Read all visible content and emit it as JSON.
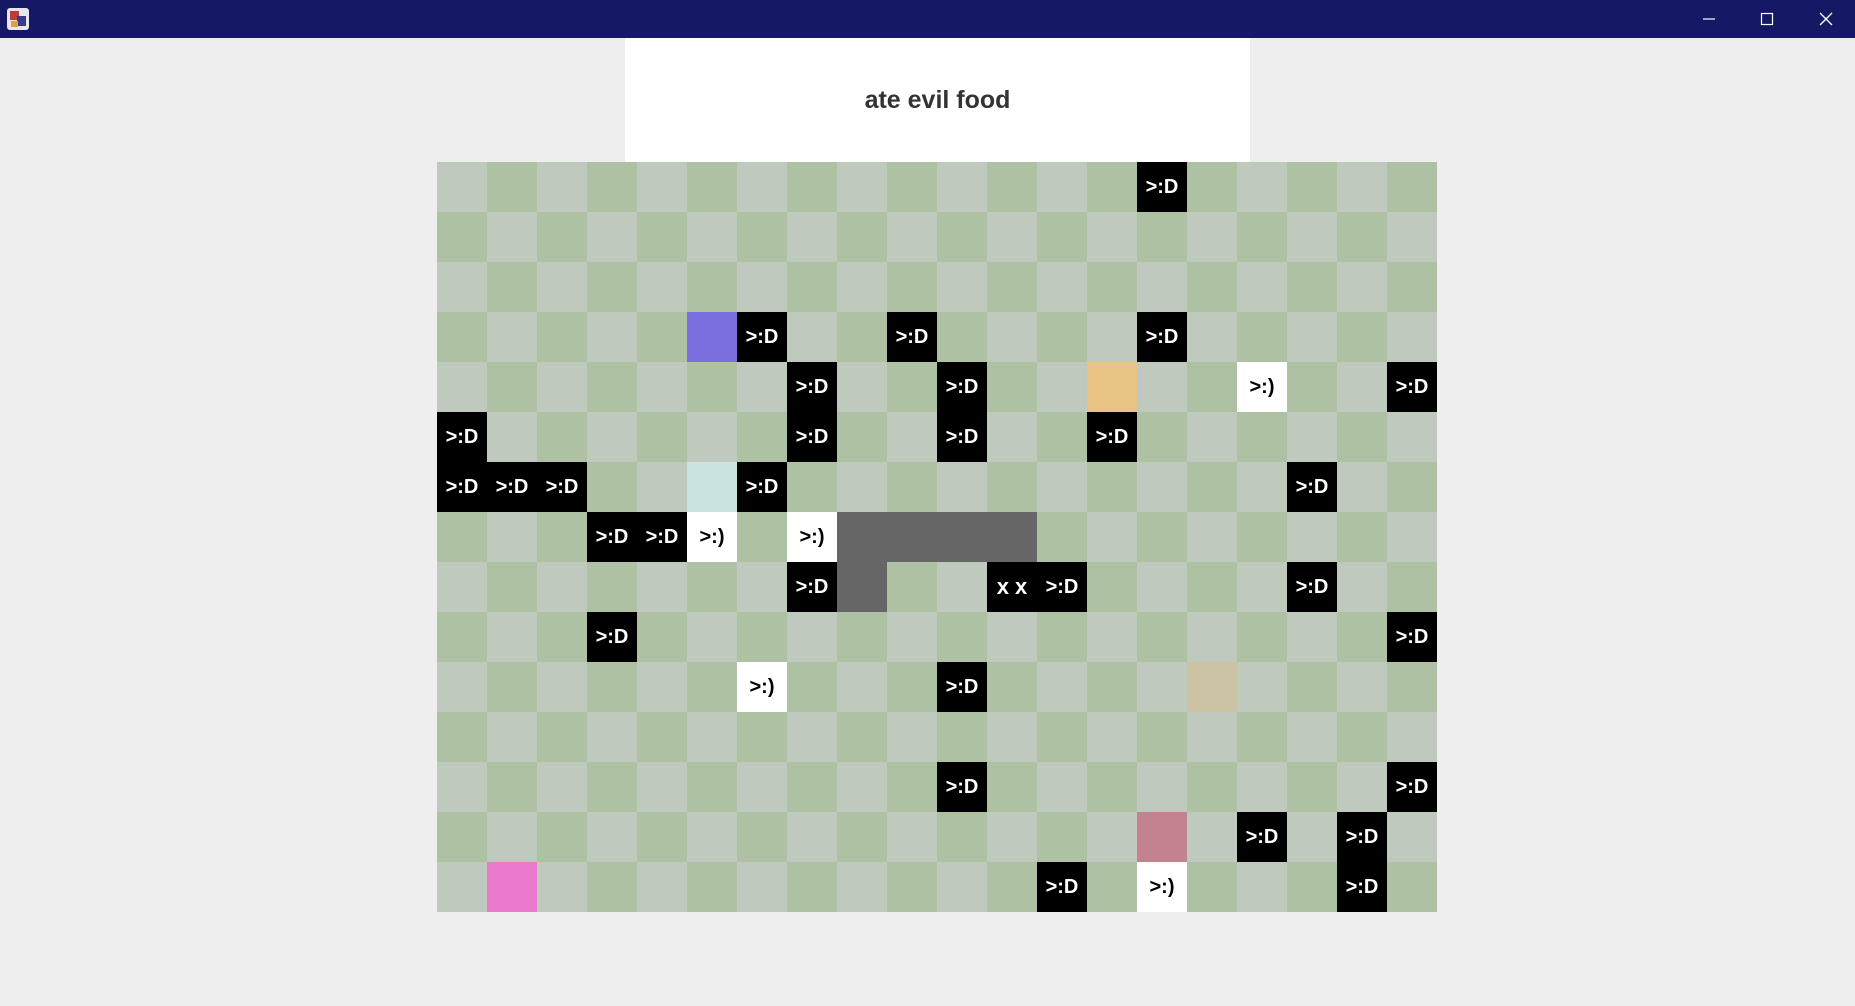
{
  "window": {
    "app_icon": "java-app-icon",
    "controls": [
      "minimize-icon",
      "maximize-icon",
      "close-icon"
    ]
  },
  "status": {
    "message": "ate evil food"
  },
  "board": {
    "cols": 20,
    "rows": 15,
    "checker_colors": {
      "light": "#bfc9be",
      "dark": "#aec1a3"
    },
    "evil_food_label": ">:D",
    "good_food_label": ">:)",
    "snake_head_label": "x x",
    "evil_food": [
      [
        14,
        0
      ],
      [
        6,
        3
      ],
      [
        9,
        3
      ],
      [
        14,
        3
      ],
      [
        7,
        4
      ],
      [
        10,
        4
      ],
      [
        19,
        4
      ],
      [
        0,
        5
      ],
      [
        7,
        5
      ],
      [
        10,
        5
      ],
      [
        13,
        5
      ],
      [
        0,
        6
      ],
      [
        1,
        6
      ],
      [
        2,
        6
      ],
      [
        6,
        6
      ],
      [
        17,
        6
      ],
      [
        3,
        7
      ],
      [
        4,
        7
      ],
      [
        7,
        8
      ],
      [
        12,
        8
      ],
      [
        17,
        8
      ],
      [
        3,
        9
      ],
      [
        19,
        9
      ],
      [
        10,
        10
      ],
      [
        10,
        12
      ],
      [
        19,
        12
      ],
      [
        16,
        13
      ],
      [
        18,
        13
      ],
      [
        12,
        14
      ],
      [
        18,
        14
      ]
    ],
    "good_food": [
      [
        16,
        4
      ],
      [
        5,
        7
      ],
      [
        7,
        7
      ],
      [
        6,
        10
      ],
      [
        14,
        14
      ]
    ],
    "snake_body": [
      [
        8,
        7
      ],
      [
        9,
        7
      ],
      [
        10,
        7
      ],
      [
        11,
        7
      ],
      [
        8,
        8
      ]
    ],
    "snake_head": [
      11,
      8
    ],
    "colored_tiles": [
      {
        "cell": [
          5,
          3
        ],
        "color": "#7b6fe0"
      },
      {
        "cell": [
          13,
          4
        ],
        "color": "#e8c384"
      },
      {
        "cell": [
          5,
          6
        ],
        "color": "#cbe3e0"
      },
      {
        "cell": [
          15,
          10
        ],
        "color": "#ccc3a4"
      },
      {
        "cell": [
          14,
          13
        ],
        "color": "#c3828f"
      },
      {
        "cell": [
          1,
          14
        ],
        "color": "#eb79cc"
      }
    ]
  }
}
